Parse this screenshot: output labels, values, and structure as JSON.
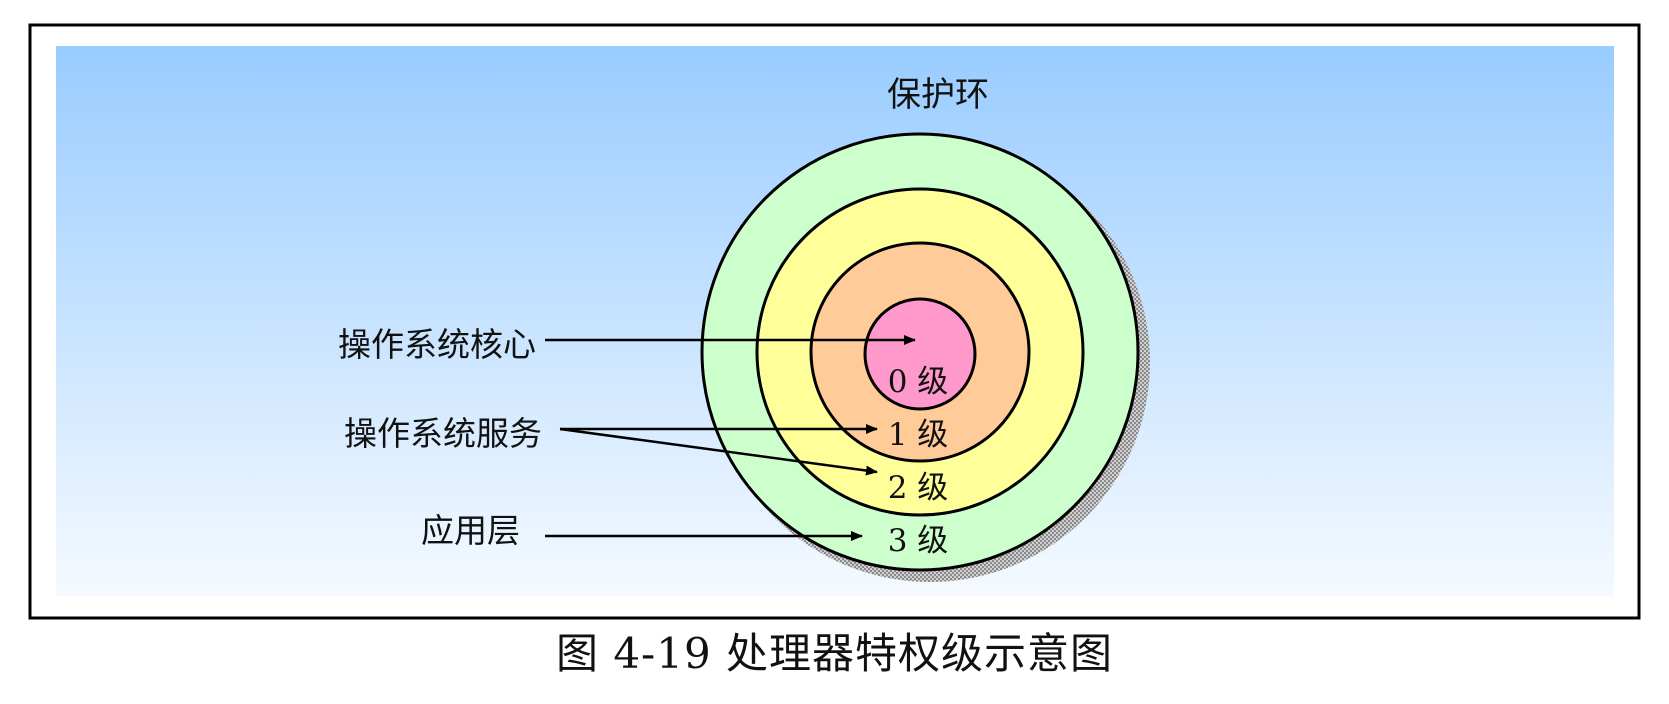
{
  "diagram": {
    "title": "保护环",
    "rings": [
      {
        "label": "0 级",
        "color": "#ff99cc"
      },
      {
        "label": "1 级",
        "color": "#ffcc99"
      },
      {
        "label": "2 级",
        "color": "#ffff99"
      },
      {
        "label": "3 级",
        "color": "#ccffcc"
      }
    ],
    "side_labels": {
      "kernel": "操作系统核心",
      "services": "操作系统服务",
      "applications": "应用层"
    },
    "colors": {
      "background_top": "#99ccff",
      "background_bottom": "#f5faff",
      "frame": "#000000",
      "shadow": "#9a9a9a"
    }
  },
  "caption": "图 4-19 处理器特权级示意图"
}
